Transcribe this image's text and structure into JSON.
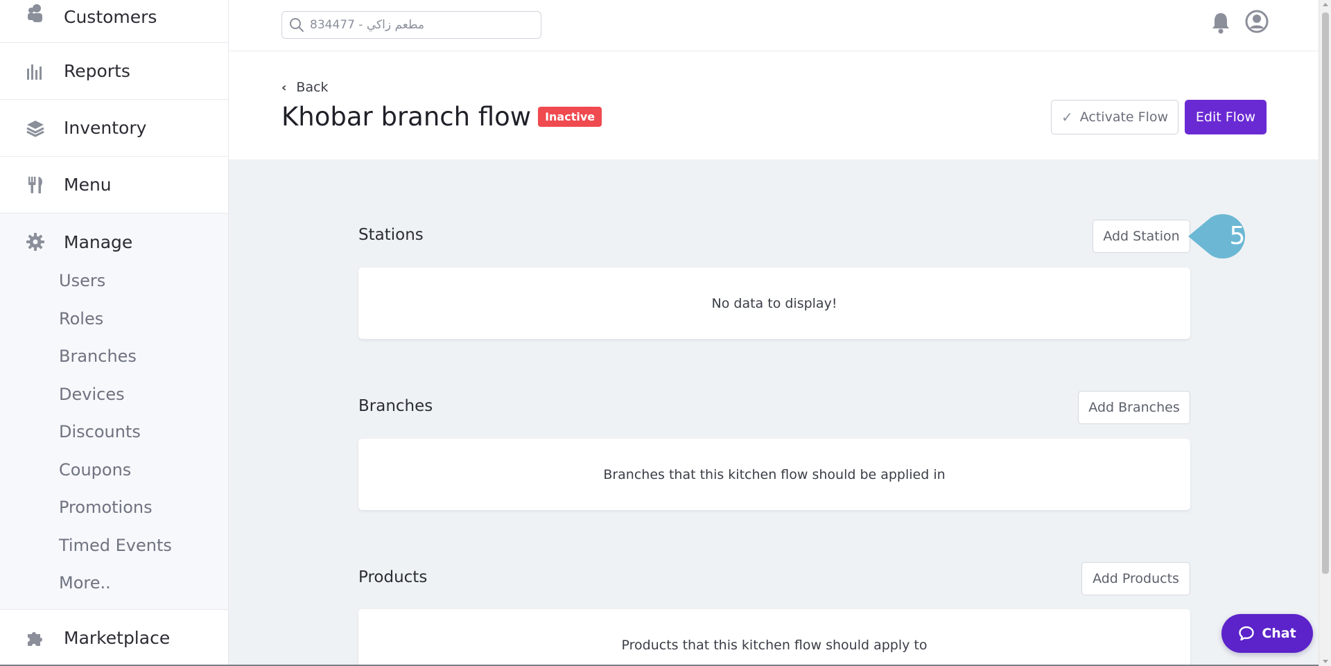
{
  "sidebar": {
    "items": [
      {
        "label": "Customers",
        "icon": "customers-icon"
      },
      {
        "label": "Reports",
        "icon": "reports-icon"
      },
      {
        "label": "Inventory",
        "icon": "inventory-icon"
      },
      {
        "label": "Menu",
        "icon": "menu-icon"
      }
    ],
    "manage": {
      "label": "Manage",
      "icon": "gear-icon",
      "sub_items": [
        "Users",
        "Roles",
        "Branches",
        "Devices",
        "Discounts",
        "Coupons",
        "Promotions",
        "Timed Events",
        "More.."
      ]
    },
    "marketplace": {
      "label": "Marketplace",
      "icon": "puzzle-icon"
    }
  },
  "topbar": {
    "search_value": "834477 - مطعم زاكي"
  },
  "header": {
    "back_label": "Back",
    "title": "Khobar branch flow",
    "status_badge": "Inactive",
    "activate_label": "Activate Flow",
    "edit_label": "Edit Flow"
  },
  "sections": {
    "stations": {
      "title": "Stations",
      "button": "Add Station",
      "empty_text": "No data to display!"
    },
    "branches": {
      "title": "Branches",
      "button": "Add Branches",
      "empty_text": "Branches that this kitchen flow should be applied in"
    },
    "products": {
      "title": "Products",
      "button": "Add Products",
      "empty_text": "Products that this kitchen flow should apply to"
    }
  },
  "step_marker": "5",
  "chat_label": "Chat",
  "colors": {
    "accent": "#6a2ad3",
    "chat": "#5b23c9",
    "inactive_badge": "#ef4a4f",
    "marker": "#6cb8d4",
    "background": "#eff2f5"
  }
}
